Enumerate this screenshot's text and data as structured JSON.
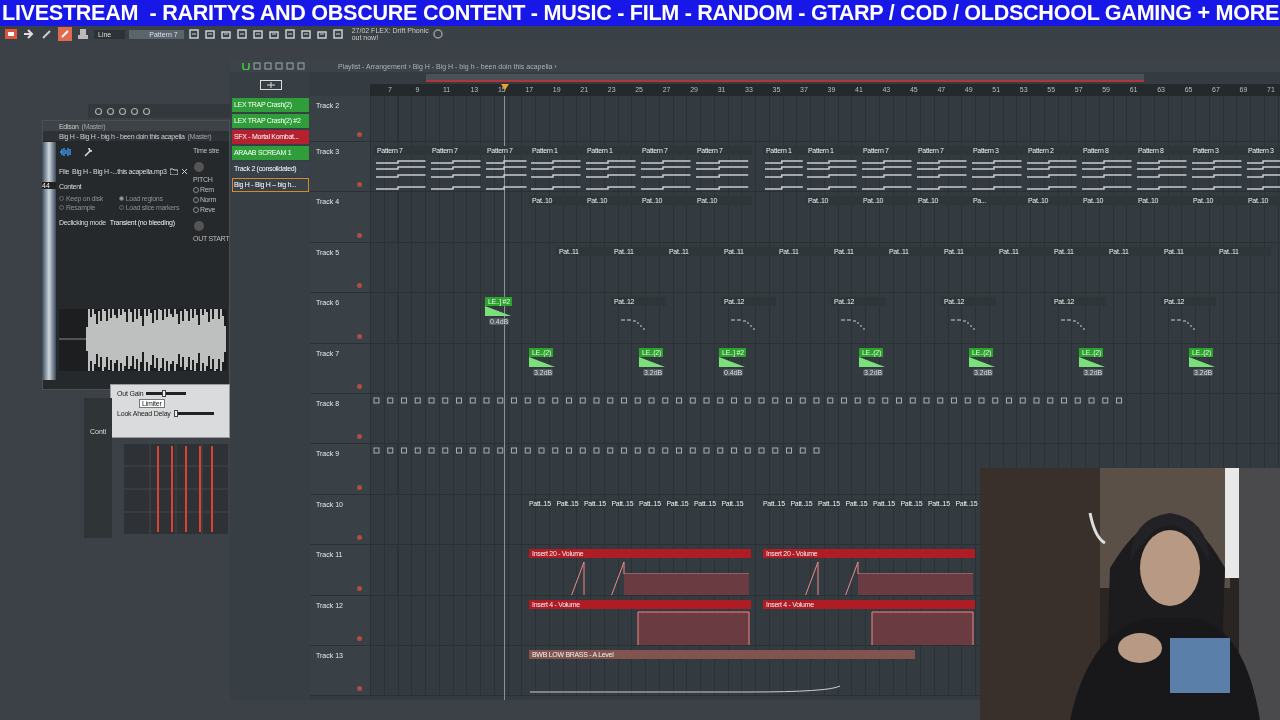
{
  "banner": {
    "text": "LIVESTREAM  - RARITYS AND OBSCURE CONTENT - MUSIC - FILM - RANDOM - GTARP / COD / OLDSCHOOL GAMING + MORE"
  },
  "toolbar": {
    "snap": "Line",
    "pattern": "Pattern 7",
    "hint": [
      "27/02 FLEX: Drift Phonic",
      "out now!"
    ]
  },
  "edison": {
    "title": "Edison",
    "title_suffix": "(Master)",
    "sample_title": "Big H - Big H - big h - been doin this acapella",
    "sample_suffix": "(Master)",
    "file_label": "File",
    "file_name": "Big H - Big H -...this acapella.mp3",
    "section": "Content",
    "options": [
      {
        "label": "Keep on disk",
        "checked": false
      },
      {
        "label": "Load regions",
        "checked": true
      },
      {
        "label": "Resample",
        "checked": false
      },
      {
        "label": "Load slice markers",
        "checked": false
      }
    ],
    "declick_label": "Declicking mode",
    "declick_value": "Transient (no bleeding)",
    "side_title": "Time stre",
    "knobs": [
      "PITCH",
      "OUT START"
    ],
    "side_options": [
      "Rem",
      "Norm",
      "Reve"
    ],
    "ruler_mark": "44"
  },
  "limiter": {
    "controls": [
      {
        "label": "Out Gain",
        "level": 0.45
      },
      {
        "label": "Look Ahead Delay",
        "level": 0.05
      }
    ],
    "mode": "Limiter"
  },
  "mixer_label": "Conti",
  "playlist": {
    "title": "Playlist - Arrangement › Big H - Big H - big h - been doin this acapella ›",
    "patterns": [
      {
        "label": "LEX TRAP Crash(2)",
        "color": "#2f9e3a",
        "selected": false
      },
      {
        "label": "LEX TRAP Crash(2) #2",
        "color": "#2f9e3a",
        "selected": false
      },
      {
        "label": "SFX - Mortal Kombat...",
        "color": "#b3222e",
        "selected": false
      },
      {
        "label": "ARAAB SCREAM 1",
        "color": "#2f9e3a",
        "selected": false
      },
      {
        "label": "Track 2 (consolidated)",
        "color": "#39424a",
        "selected": false
      },
      {
        "label": "Big H - Big H – big h...",
        "color": "#39424a",
        "selected": true
      }
    ],
    "ruler": [
      "7",
      "9",
      "11",
      "13",
      "15",
      "17",
      "19",
      "21",
      "23",
      "25",
      "27",
      "29",
      "31",
      "33",
      "35",
      "37",
      "39",
      "41",
      "43",
      "45",
      "47",
      "49",
      "51",
      "53",
      "55",
      "57",
      "59",
      "61",
      "63",
      "65",
      "67",
      "69",
      "71"
    ],
    "tracks": [
      {
        "name": "Track 2"
      },
      {
        "name": "Track 3",
        "clips": [
          {
            "kind": "pattern",
            "label": "Pattern 7"
          },
          {
            "kind": "pattern",
            "label": "Pattern 7"
          },
          {
            "kind": "pattern",
            "label": "Pattern 7"
          },
          {
            "kind": "pattern",
            "label": "Pattern 1"
          },
          {
            "kind": "pattern",
            "label": "Pattern 1"
          },
          {
            "kind": "pattern",
            "label": "Pattern 7"
          },
          {
            "kind": "pattern",
            "label": "Pattern 7"
          },
          {
            "kind": "pattern",
            "label": "Pattern 1"
          },
          {
            "kind": "pattern",
            "label": "Pattern 1"
          },
          {
            "kind": "pattern",
            "label": "Pattern 7"
          },
          {
            "kind": "pattern",
            "label": "Pattern 7"
          },
          {
            "kind": "pattern",
            "label": "Pattern 3"
          },
          {
            "kind": "pattern",
            "label": "Pattern 2"
          },
          {
            "kind": "pattern",
            "label": "Pattern 8"
          },
          {
            "kind": "pattern",
            "label": "Pattern 8"
          },
          {
            "kind": "pattern",
            "label": "Pattern 3"
          },
          {
            "kind": "pattern",
            "label": "Pattern 3"
          }
        ]
      },
      {
        "name": "Track 4",
        "clips": [
          {
            "kind": "pattern",
            "label": "Pat..10"
          },
          {
            "kind": "pattern",
            "label": "Pat..10"
          },
          {
            "kind": "pattern",
            "label": "Pat..10"
          },
          {
            "kind": "pattern",
            "label": "Pat..10"
          },
          {
            "kind": "pattern",
            "label": "Pat..10"
          },
          {
            "kind": "pattern",
            "label": "Pat..10"
          },
          {
            "kind": "pattern",
            "label": "Pat..10"
          },
          {
            "kind": "pattern",
            "label": "Pa..."
          },
          {
            "kind": "pattern",
            "label": "Pat..10"
          },
          {
            "kind": "pattern",
            "label": "Pat..10"
          },
          {
            "kind": "pattern",
            "label": "Pat..10"
          },
          {
            "kind": "pattern",
            "label": "Pat..10"
          },
          {
            "kind": "pattern",
            "label": "Pat..10"
          }
        ]
      },
      {
        "name": "Track 5",
        "clips": [
          {
            "kind": "pattern",
            "label": "Pat..11"
          },
          {
            "kind": "pattern",
            "label": "Pat..11"
          },
          {
            "kind": "pattern",
            "label": "Pat..11"
          },
          {
            "kind": "pattern",
            "label": "Pat..11"
          },
          {
            "kind": "pattern",
            "label": "Pat..11"
          },
          {
            "kind": "pattern",
            "label": "Pat..11"
          },
          {
            "kind": "pattern",
            "label": "Pat..11"
          },
          {
            "kind": "pattern",
            "label": "Pat..11"
          },
          {
            "kind": "pattern",
            "label": "Pat..11"
          },
          {
            "kind": "pattern",
            "label": "Pat..11"
          },
          {
            "kind": "pattern",
            "label": "Pat..11"
          },
          {
            "kind": "pattern",
            "label": "Pat..11"
          },
          {
            "kind": "pattern",
            "label": "Pat..11"
          }
        ]
      },
      {
        "name": "Track 6",
        "clips": [
          {
            "kind": "audio",
            "label": "LE..] #2",
            "gain": "0.4dB"
          },
          {
            "kind": "pattern",
            "label": "Pat..12"
          },
          {
            "kind": "pattern",
            "label": "Pat..12"
          },
          {
            "kind": "pattern",
            "label": "Pat..12"
          },
          {
            "kind": "pattern",
            "label": "Pat..12"
          },
          {
            "kind": "pattern",
            "label": "Pat..12"
          },
          {
            "kind": "pattern",
            "label": "Pat..12"
          }
        ]
      },
      {
        "name": "Track 7",
        "clips": [
          {
            "kind": "audio",
            "label": "LE..(2)",
            "gain": "3.2dB"
          },
          {
            "kind": "audio",
            "label": "LE..(2)",
            "gain": "3.2dB"
          },
          {
            "kind": "audio",
            "label": "LE..] #2",
            "gain": "0.4dB"
          },
          {
            "kind": "audio",
            "label": "LE..(2)",
            "gain": "3.2dB"
          },
          {
            "kind": "audio",
            "label": "LE..(2)",
            "gain": "3.2dB"
          },
          {
            "kind": "audio",
            "label": "LE..(2)",
            "gain": "3.2dB"
          },
          {
            "kind": "audio",
            "label": "LE..(2)",
            "gain": "3.2dB"
          }
        ]
      },
      {
        "name": "Track 8",
        "kind": "steps"
      },
      {
        "name": "Track 9",
        "kind": "steps"
      },
      {
        "name": "Track 10",
        "clips": [
          {
            "kind": "mini",
            "label": "Patt..15"
          },
          {
            "kind": "mini",
            "label": "Patt..15"
          },
          {
            "kind": "mini",
            "label": "Patt..15"
          },
          {
            "kind": "mini",
            "label": "Patt..15"
          },
          {
            "kind": "mini",
            "label": "Patt..15"
          },
          {
            "kind": "mini",
            "label": "Patt..15"
          },
          {
            "kind": "mini",
            "label": "Patt..15"
          },
          {
            "kind": "mini",
            "label": "Patt..15"
          },
          {
            "kind": "mini",
            "label": "Patt..15"
          },
          {
            "kind": "mini",
            "label": "Patt..15"
          },
          {
            "kind": "mini",
            "label": "Patt..15"
          },
          {
            "kind": "mini",
            "label": "Patt..15"
          },
          {
            "kind": "mini",
            "label": "Patt..15"
          },
          {
            "kind": "mini",
            "label": "Patt..15"
          },
          {
            "kind": "mini",
            "label": "Patt..15"
          },
          {
            "kind": "mini",
            "label": "Patt..15"
          }
        ]
      },
      {
        "name": "Track 11",
        "clips": [
          {
            "kind": "automation",
            "label": "Insert 20 - Volume"
          },
          {
            "kind": "automation",
            "label": "Insert 20 - Volume"
          }
        ]
      },
      {
        "name": "Track 12",
        "clips": [
          {
            "kind": "automation",
            "label": "Insert 4 - Volume"
          },
          {
            "kind": "automation",
            "label": "Insert 4 - Volume"
          }
        ]
      },
      {
        "name": "Track 13",
        "clips": [
          {
            "kind": "level",
            "label": "BWB LOW BRASS - A Level"
          }
        ]
      }
    ]
  }
}
